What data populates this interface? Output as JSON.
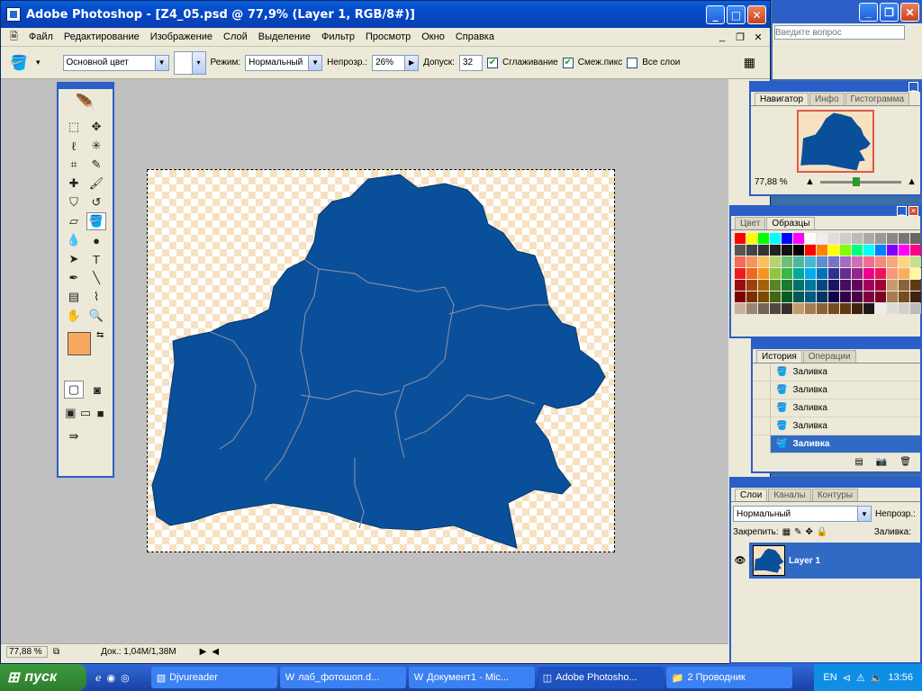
{
  "window": {
    "title": "Adobe Photoshop - [Z4_05.psd @ 77,9% (Layer 1, RGB/8#)]"
  },
  "menu": [
    "Файл",
    "Редактирование",
    "Изображение",
    "Слой",
    "Выделение",
    "Фильтр",
    "Просмотр",
    "Окно",
    "Справка"
  ],
  "options": {
    "fill_source": "Основной цвет",
    "mode_label": "Режим:",
    "mode_value": "Нормальный",
    "opacity_label": "Непрозр.:",
    "opacity_value": "26%",
    "tolerance_label": "Допуск:",
    "tolerance_value": "32",
    "antialias": "Сглаживание",
    "contiguous": "Смеж.пикс",
    "all_layers": "Все слои"
  },
  "help_search": {
    "placeholder": "Введите вопрос"
  },
  "colors": {
    "foreground": "#f9a95f",
    "background": "#c8a586",
    "map_fill": "#0a4f9a"
  },
  "navigator": {
    "tabs": [
      "Навигатор",
      "Инфо",
      "Гистограмма"
    ],
    "zoom": "77,88 %"
  },
  "swatches_panel": {
    "tabs": [
      "Цвет",
      "Образцы"
    ]
  },
  "history": {
    "tabs": [
      "История",
      "Операции"
    ],
    "items": [
      "Заливка",
      "Заливка",
      "Заливка",
      "Заливка",
      "Заливка"
    ]
  },
  "layers": {
    "tabs": [
      "Слои",
      "Каналы",
      "Контуры"
    ],
    "blend": "Нормальный",
    "opacity_label": "Непрозр.:",
    "lock_label": "Закрепить:",
    "fill_label": "Заливка:",
    "layer_name": "Layer 1"
  },
  "status": {
    "zoom": "77,88 %",
    "doc": "Док.: 1,04M/1,38M"
  },
  "taskbar": {
    "start": "пуск",
    "items": [
      "Djvureader",
      "лаб_фотошоп.d...",
      "Документ1 - Mic...",
      "Adobe Photosho...",
      "2 Проводник"
    ],
    "lang": "EN",
    "time": "13:56"
  }
}
